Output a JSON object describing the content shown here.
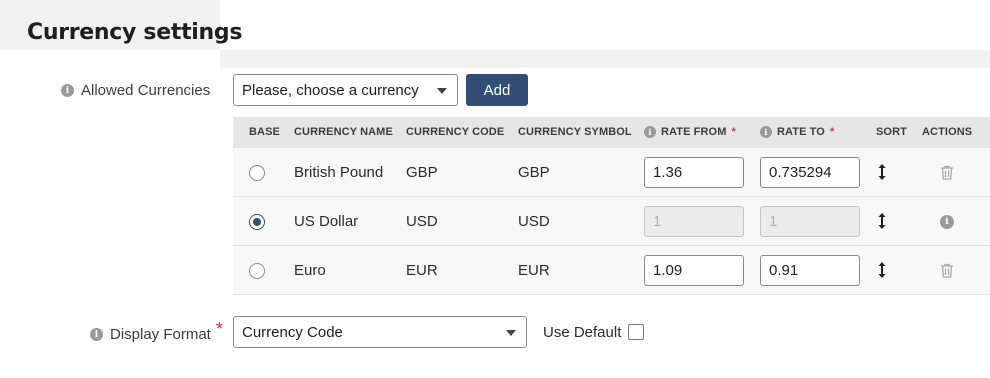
{
  "panel": {
    "title": "Currency settings"
  },
  "allowed_currencies": {
    "label": "Allowed Currencies",
    "select_value": "Please, choose a currency",
    "add_label": "Add"
  },
  "table": {
    "headers": {
      "base": "BASE",
      "name": "CURRENCY NAME",
      "code": "CURRENCY CODE",
      "symbol": "CURRENCY SYMBOL",
      "rate_from": "RATE FROM",
      "rate_to": "RATE TO",
      "sort": "SORT",
      "actions": "ACTIONS",
      "required_mark": "*"
    },
    "rows": [
      {
        "name": "British Pound",
        "code": "GBP",
        "symbol": "GBP",
        "rate_from": "1.36",
        "rate_to": "0.735294"
      },
      {
        "name": "US Dollar",
        "code": "USD",
        "symbol": "USD",
        "rate_from": "1",
        "rate_to": "1"
      },
      {
        "name": "Euro",
        "code": "EUR",
        "symbol": "EUR",
        "rate_from": "1.09",
        "rate_to": "0.91"
      }
    ]
  },
  "display_format": {
    "label": "Display Format",
    "required_mark": "*",
    "select_value": "Currency Code",
    "use_default_label": "Use Default"
  },
  "icons": {
    "info": "info-icon",
    "sort": "sort-arrows-icon",
    "delete": "trash-icon"
  },
  "colors": {
    "accent": "#324d76",
    "required": "#d0342c",
    "background": "#f1f1f1"
  }
}
